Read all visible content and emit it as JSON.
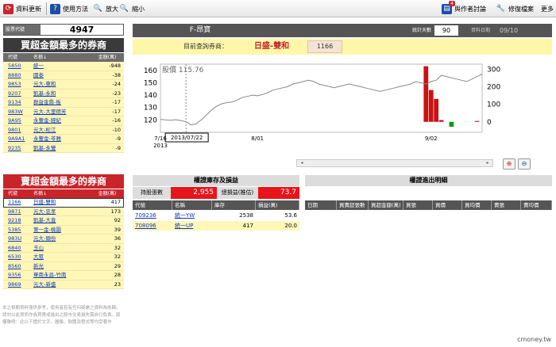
{
  "toolbar": {
    "refresh": "資料更新",
    "help": "使用方法",
    "zoom_in": "放大",
    "zoom_out": "縮小",
    "discuss_badge": "4",
    "discuss": "與作者討論",
    "repair": "修復檔案",
    "more": "更多"
  },
  "stock_code": {
    "label": "股票代號",
    "value": "4947"
  },
  "buy_panel": {
    "title": "買超金額最多的券商",
    "headers": [
      "代號",
      "名稱↓",
      "金額(萬)"
    ],
    "rows": [
      {
        "code": "5850",
        "name": "統一",
        "amount": "-948"
      },
      {
        "code": "8880",
        "name": "國泰",
        "amount": "-38"
      },
      {
        "code": "9853",
        "name": "元大-東和",
        "amount": "-24"
      },
      {
        "code": "9207",
        "name": "凱基-永和",
        "amount": "-23"
      },
      {
        "code": "9134",
        "name": "群益金鼎-板",
        "amount": "-17"
      },
      {
        "code": "983W",
        "name": "元大-大里德芳",
        "amount": "-17"
      },
      {
        "code": "9A95",
        "name": "永豐金-經紀",
        "amount": "-16"
      },
      {
        "code": "9801",
        "name": "元大-松江",
        "amount": "-10"
      },
      {
        "code": "9A9A1",
        "name": "永豐金-苓雅",
        "amount": "-9"
      },
      {
        "code": "9235",
        "name": "凱基-永豐",
        "amount": "-9"
      }
    ]
  },
  "sell_panel": {
    "title": "賣超金額最多的券商",
    "headers": [
      "代號",
      "名稱↓",
      "金額(萬)"
    ],
    "rows": [
      {
        "code": "1166",
        "name": "日盛-雙和",
        "amount": "417"
      },
      {
        "code": "9871",
        "name": "元大-忠孝",
        "amount": "173"
      },
      {
        "code": "9218",
        "name": "凱基-大直",
        "amount": "92"
      },
      {
        "code": "5385",
        "name": "第一金-桃園",
        "amount": "39"
      },
      {
        "code": "983U",
        "name": "元大-頭份",
        "amount": "36"
      },
      {
        "code": "6840",
        "name": "玉山",
        "amount": "32"
      },
      {
        "code": "6530",
        "name": "大眾",
        "amount": "32"
      },
      {
        "code": "8560",
        "name": "新光",
        "amount": "29"
      },
      {
        "code": "9356",
        "name": "華南永昌-竹南",
        "amount": "28"
      },
      {
        "code": "9869",
        "name": "元大-新盛",
        "amount": "23"
      }
    ]
  },
  "disclaimer": "本之相關資料僅供參考，使用者若有任何疑慮之資料為依歸。請勿以此資訊作為買賣或進出之股市交易損失需自行負責。版權聲明：此以下證於文字、圖像、軟體及程式等均受著作",
  "main": {
    "stock_name": "F-昂寶",
    "days_label": "統計天數",
    "days_value": "90",
    "date_label": "資料日期",
    "date_value": "09/10",
    "query_label": "目前查詢券商：",
    "broker_name": "日盛-雙和",
    "broker_code": "1166"
  },
  "chart_data": {
    "type": "line",
    "title": "",
    "price_label": "股價 115.76",
    "cursor_date": "2013/07/22",
    "x_ticks": [
      "7/16\n2013",
      "8/01",
      "9/02"
    ],
    "y_left": {
      "ticks": [
        160,
        150,
        140,
        130,
        120
      ],
      "range": [
        110,
        165
      ]
    },
    "y_right": {
      "ticks": [
        300,
        200,
        100,
        0
      ],
      "range": [
        -60,
        330
      ]
    },
    "price_series": [
      120.5,
      120,
      119.8,
      120.2,
      119.5,
      118.5,
      116,
      117,
      120,
      124,
      128,
      131,
      133,
      134,
      134.5,
      136,
      138,
      139,
      140,
      139.5,
      140.5,
      142,
      144,
      145,
      146,
      147,
      149,
      150,
      151,
      152,
      151,
      149,
      148,
      147,
      146,
      147,
      148,
      149,
      148,
      147,
      146,
      145,
      144,
      143,
      144,
      145,
      146,
      147,
      148,
      149,
      151,
      150,
      149,
      151,
      152,
      156,
      155,
      154,
      153,
      152,
      151,
      153,
      155,
      157
    ],
    "bar_series": [
      {
        "index": 52,
        "value": 318,
        "color": "#cc1111"
      },
      {
        "index": 53,
        "value": 182,
        "color": "#cc1111"
      },
      {
        "index": 54,
        "value": 131,
        "color": "#cc1111"
      },
      {
        "index": 55,
        "value": 10,
        "color": "#cc1111"
      },
      {
        "index": 57,
        "value": -28,
        "color": "#119911"
      },
      {
        "index": 62,
        "value": 5,
        "color": "#cc1111"
      }
    ]
  },
  "holdings": {
    "title": "權證庫存及損益",
    "shares_label": "持股張數",
    "shares_value": "2,955",
    "pl_label": "總損益(推估)",
    "pl_value": "73.7",
    "headers": [
      "代號",
      "名稱",
      "庫存",
      "損益(萬)"
    ],
    "rows": [
      {
        "code": "709236",
        "name": "統一YW",
        "stock": "2538",
        "pl": "53.6"
      },
      {
        "code": "708096",
        "name": "統一UP",
        "stock": "417",
        "pl": "20.0"
      }
    ]
  },
  "trades": {
    "title": "權證進出明細",
    "headers": [
      "日期",
      "買賣超張數",
      "買超金額(萬)",
      "買張",
      "買價",
      "買均價",
      "賣張",
      "賣均價"
    ]
  },
  "footer": "cmoney.tw"
}
